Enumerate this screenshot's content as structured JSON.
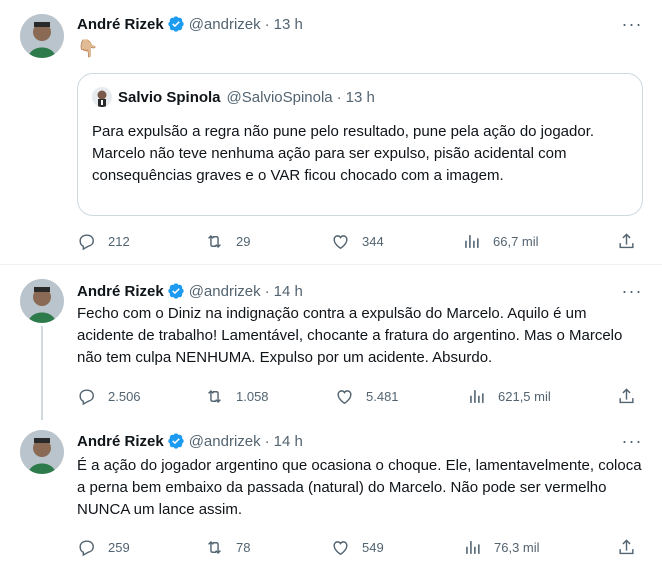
{
  "tweets": [
    {
      "name": "André Rizek",
      "handle": "@andrizek",
      "time": "13 h",
      "body": "👇🏼",
      "quote": {
        "name": "Salvio Spinola",
        "handle": "@SalvioSpinola",
        "time": "13 h",
        "lines": [
          "Para expulsão a regra não pune pelo resultado, pune pela ação do jogador.",
          "Marcelo não teve nenhuma ação para ser expulso, pisão acidental com consequências graves e o VAR ficou chocado com a imagem."
        ]
      },
      "replies": "212",
      "retweets": "29",
      "likes": "344",
      "views": "66,7 mil"
    },
    {
      "name": "André Rizek",
      "handle": "@andrizek",
      "time": "14 h",
      "body": "Fecho com o Diniz na indignação contra a expulsão do Marcelo. Aquilo é um acidente de trabalho! Lamentável, chocante a fratura do argentino. Mas o Marcelo não tem culpa NENHUMA. Expulso por um acidente. Absurdo.",
      "replies": "2.506",
      "retweets": "1.058",
      "likes": "5.481",
      "views": "621,5 mil"
    },
    {
      "name": "André Rizek",
      "handle": "@andrizek",
      "time": "14 h",
      "body": "É a ação do jogador argentino que ocasiona o choque. Ele, lamentavelmente, coloca a perna bem embaixo da passada (natural) do Marcelo. Não pode ser vermelho NUNCA um lance assim.",
      "replies": "259",
      "retweets": "78",
      "likes": "549",
      "views": "76,3 mil"
    }
  ],
  "colors": {
    "text": "#0f1419",
    "secondary": "#536471",
    "border": "#cfd9de",
    "verified": "#1d9bf0"
  },
  "icons": [
    "reply-icon",
    "retweet-icon",
    "like-icon",
    "views-icon",
    "share-icon",
    "more-icon",
    "verified-badge-icon"
  ]
}
